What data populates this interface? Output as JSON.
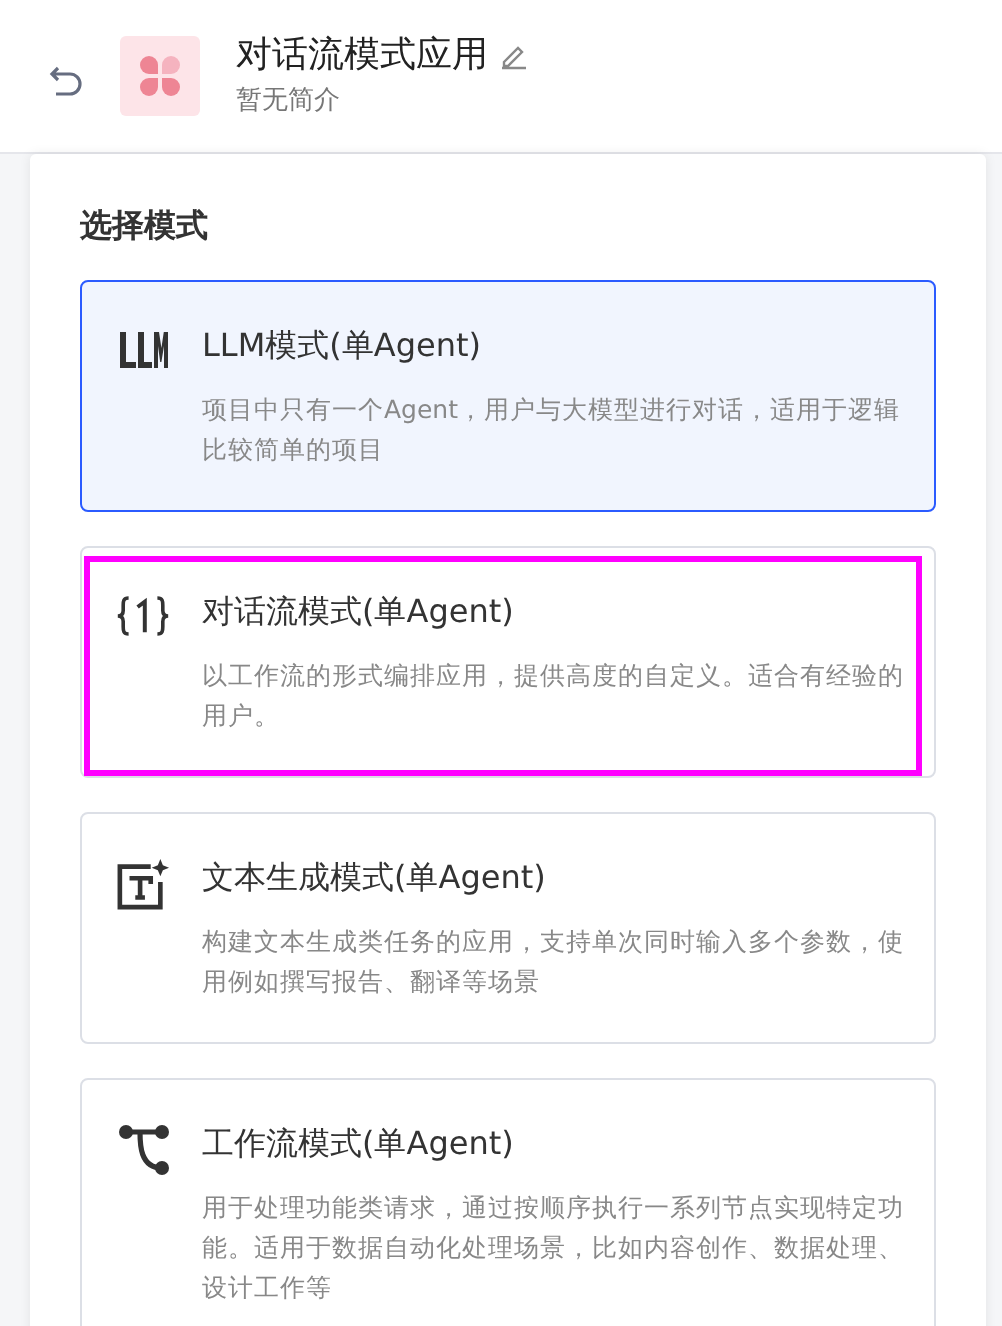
{
  "header": {
    "title": "对话流模式应用",
    "subtitle": "暂无简介"
  },
  "panel": {
    "title": "选择模式",
    "modes": [
      {
        "kind": "llm",
        "title": "LLM模式(单Agent)",
        "description": "项目中只有一个Agent，用户与大模型进行对话，适用于逻辑比较简单的项目",
        "selected": true,
        "highlighted": false
      },
      {
        "kind": "dialog-flow",
        "title": "对话流模式(单Agent)",
        "description": "以工作流的形式编排应用，提供高度的自定义。适合有经验的用户。",
        "selected": false,
        "highlighted": true
      },
      {
        "kind": "text-gen",
        "title": "文本生成模式(单Agent)",
        "description": "构建文本生成类任务的应用，支持单次同时输入多个参数，使用例如撰写报告、翻译等场景",
        "selected": false,
        "highlighted": false
      },
      {
        "kind": "workflow",
        "title": "工作流模式(单Agent)",
        "description": "用于处理功能类请求，通过按顺序执行一系列节点实现特定功能。适用于数据自动化处理场景，比如内容创作、数据处理、设计工作等",
        "selected": false,
        "highlighted": false
      }
    ]
  }
}
